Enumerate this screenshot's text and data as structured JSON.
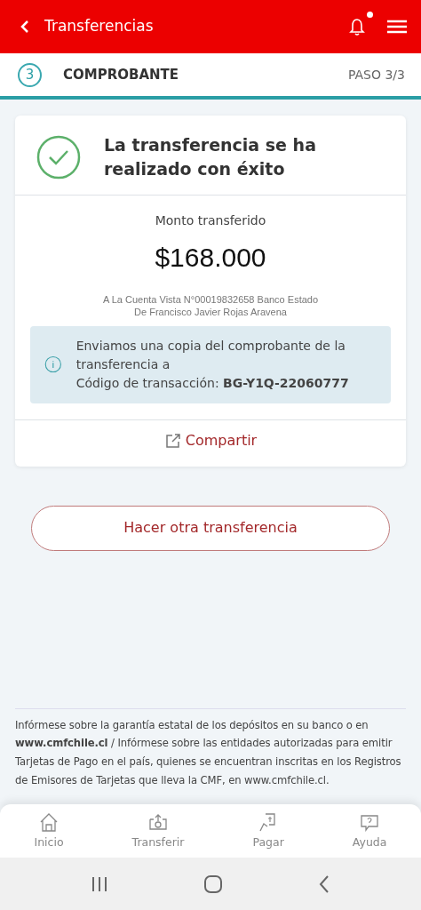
{
  "header": {
    "title": "Transferencias",
    "notification_unread": true
  },
  "step": {
    "number": "3",
    "title": "COMPROBANTE",
    "progress": "PASO 3/3",
    "level": 1
  },
  "receipt": {
    "headline": "La transferencia se ha realizado con éxito",
    "amount_label": "Monto transferido",
    "amount": "$168.000",
    "account_lines": [
      "A La Cuenta Vista N°00019832658 Banco Estado",
      "De Francisco Javier Rojas Aravena"
    ],
    "info_message": "Enviamos una copia del comprobante de la transferencia a",
    "info_code": "Código de transacción: **BG-Y1Q-22060777**",
    "share": "Compartir"
  },
  "secondary_button": "Hacer otra transferencia",
  "disclaimer": "Infórmese sobre la garantía estatal de los depósitos en su banco o en **www.cmfchile.cl** / Infórmese sobre las entidades autorizadas para emitir Tarjetas de Pago en el país, quienes se encuentran inscritas en los Registros de Emisores de Tarjetas que lleva la CMF, en www.cmfchile.cl.",
  "bottom_nav": [
    {
      "kind": "home",
      "label": "Inicio",
      "selected": false
    },
    {
      "kind": "transfer",
      "label": "Transferir",
      "selected": false
    },
    {
      "kind": "pay",
      "label": "Pagar",
      "selected": false
    },
    {
      "kind": "help",
      "label": "Ayuda",
      "selected": false
    }
  ]
}
